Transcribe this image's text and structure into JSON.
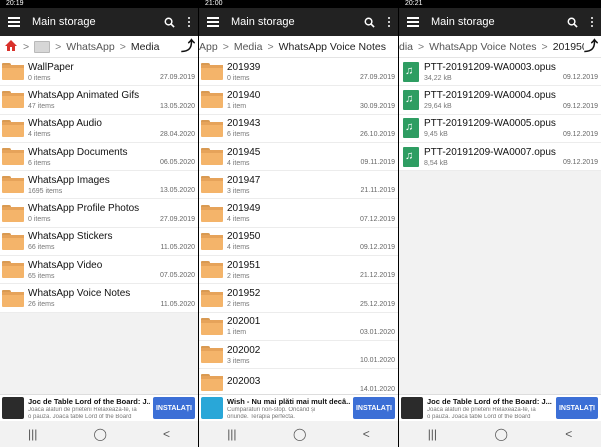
{
  "panels": [
    {
      "status_time": "20:19",
      "toolbar_title": "Main storage",
      "crumbs": [
        "WhatsApp",
        "Media"
      ],
      "items": [
        {
          "name": "WallPaper",
          "meta": "0 items",
          "date": "27.09.2019"
        },
        {
          "name": "WhatsApp Animated Gifs",
          "meta": "47 items",
          "date": "13.05.2020"
        },
        {
          "name": "WhatsApp Audio",
          "meta": "4 items",
          "date": "28.04.2020"
        },
        {
          "name": "WhatsApp Documents",
          "meta": "6 items",
          "date": "06.05.2020"
        },
        {
          "name": "WhatsApp Images",
          "meta": "1695 items",
          "date": "13.05.2020"
        },
        {
          "name": "WhatsApp Profile Photos",
          "meta": "0 items",
          "date": "27.09.2019"
        },
        {
          "name": "WhatsApp Stickers",
          "meta": "66 items",
          "date": "11.05.2020"
        },
        {
          "name": "WhatsApp Video",
          "meta": "65 items",
          "date": "07.05.2020"
        },
        {
          "name": "WhatsApp Voice Notes",
          "meta": "26 items",
          "date": "11.05.2020"
        }
      ],
      "ad": {
        "title": "Joc de Table Lord of the Board: J...",
        "sub1": "Joacă alături de prieteni Relaxează-te, ia",
        "sub2": "o pauză. Joacă table Lord of the Board",
        "button": "INSTALAȚI"
      }
    },
    {
      "status_time": "21:00",
      "toolbar_title": "Main storage",
      "crumbs": [
        "App",
        "Media",
        "WhatsApp Voice Notes"
      ],
      "items": [
        {
          "name": "201939",
          "meta": "0 items",
          "date": "27.09.2019"
        },
        {
          "name": "201940",
          "meta": "1 item",
          "date": "30.09.2019"
        },
        {
          "name": "201943",
          "meta": "6 items",
          "date": "26.10.2019"
        },
        {
          "name": "201945",
          "meta": "4 items",
          "date": "09.11.2019"
        },
        {
          "name": "201947",
          "meta": "3 items",
          "date": "21.11.2019"
        },
        {
          "name": "201949",
          "meta": "4 items",
          "date": "07.12.2019"
        },
        {
          "name": "201950",
          "meta": "4 items",
          "date": "09.12.2019"
        },
        {
          "name": "201951",
          "meta": "2 items",
          "date": "21.12.2019"
        },
        {
          "name": "201952",
          "meta": "2 items",
          "date": "25.12.2019"
        },
        {
          "name": "202001",
          "meta": "1 item",
          "date": "03.01.2020"
        },
        {
          "name": "202002",
          "meta": "3 items",
          "date": "10.01.2020"
        },
        {
          "name": "202003",
          "meta": "",
          "date": "14.01.2020"
        }
      ],
      "ad": {
        "title": "Wish - Nu mai plăti mai mult decâ...",
        "sub1": "Cumpărături non-stop. Oricând și",
        "sub2": "oriunde. Terapia perfectă.",
        "button": "INSTALAȚI"
      }
    },
    {
      "status_time": "20:21",
      "toolbar_title": "Main storage",
      "crumbs": [
        "dia",
        "WhatsApp Voice Notes",
        "201950"
      ],
      "items": [
        {
          "name": "PTT-20191209-WA0003.opus",
          "meta": "34,22 kB",
          "date": "09.12.2019"
        },
        {
          "name": "PTT-20191209-WA0004.opus",
          "meta": "29,64 kB",
          "date": "09.12.2019"
        },
        {
          "name": "PTT-20191209-WA0005.opus",
          "meta": "9,45 kB",
          "date": "09.12.2019"
        },
        {
          "name": "PTT-20191209-WA0007.opus",
          "meta": "8,54 kB",
          "date": "09.12.2019"
        }
      ],
      "ad": {
        "title": "Joc de Table Lord of the Board: J...",
        "sub1": "Joacă alături de prieteni Relaxează-te, ia",
        "sub2": "o pauză. Joacă table Lord of the Board",
        "button": "INSTALAȚI"
      }
    }
  ],
  "icons": {
    "menu": "menu-icon",
    "search": "search-icon",
    "more": "more-vert-icon",
    "up": "up-arrow-icon",
    "folder": "folder-icon",
    "audio": "audio-file-icon",
    "home": "home-icon"
  },
  "colors": {
    "toolbar": "#222222",
    "folder": "#f4b46a",
    "audio_file": "#2e9d62",
    "install_button": "#3c6fd6",
    "home": "#d9312b"
  }
}
